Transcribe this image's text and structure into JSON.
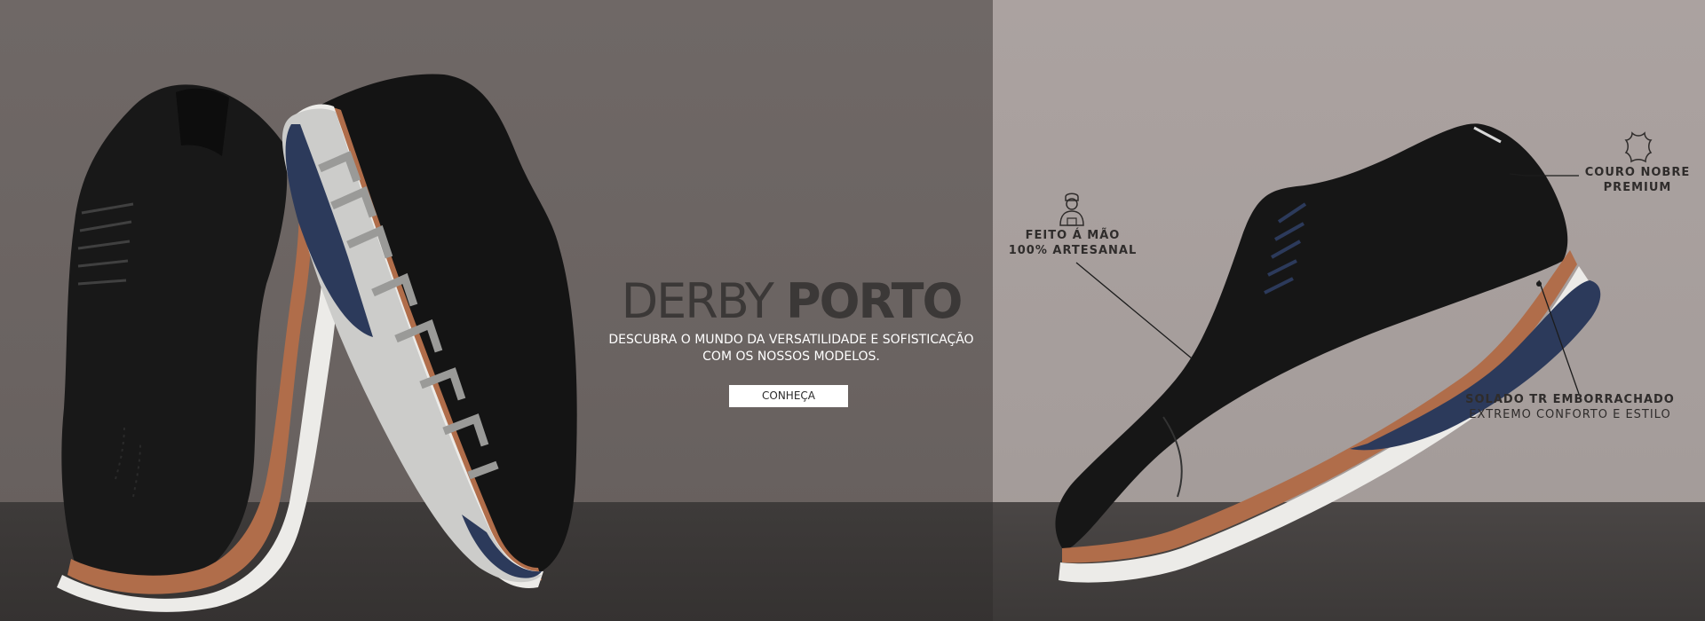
{
  "headline": {
    "light": "DERBY",
    "bold": "PORTO"
  },
  "subtext": {
    "line1": "DESCUBRA O MUNDO DA VERSATILIDADE E SOFISTICAÇÃO",
    "line2": "COM OS NOSSOS MODELOS."
  },
  "cta": {
    "label": "CONHEÇA"
  },
  "features": {
    "handmade": {
      "line1": "FEITO Á MÃO",
      "line2": "100% ARTESANAL",
      "icon": "craftsman-icon"
    },
    "leather": {
      "line1": "COURO NOBRE",
      "line2": "PREMIUM",
      "icon": "leather-hide-icon"
    },
    "sole": {
      "line1": "SOLADO TR EMBORRACHADO",
      "line2": "EXTREMO CONFORTO E ESTILO"
    }
  },
  "colors": {
    "left_background": "#6f6866",
    "right_background": "#aba2a0",
    "floor": "#3e3b3a",
    "headline_text": "#3b3837",
    "shoe_leather": "#161616",
    "sole_accent": "#b06d4a",
    "sole_navy": "#2c3a5b",
    "sole_white": "#ecebe8"
  }
}
